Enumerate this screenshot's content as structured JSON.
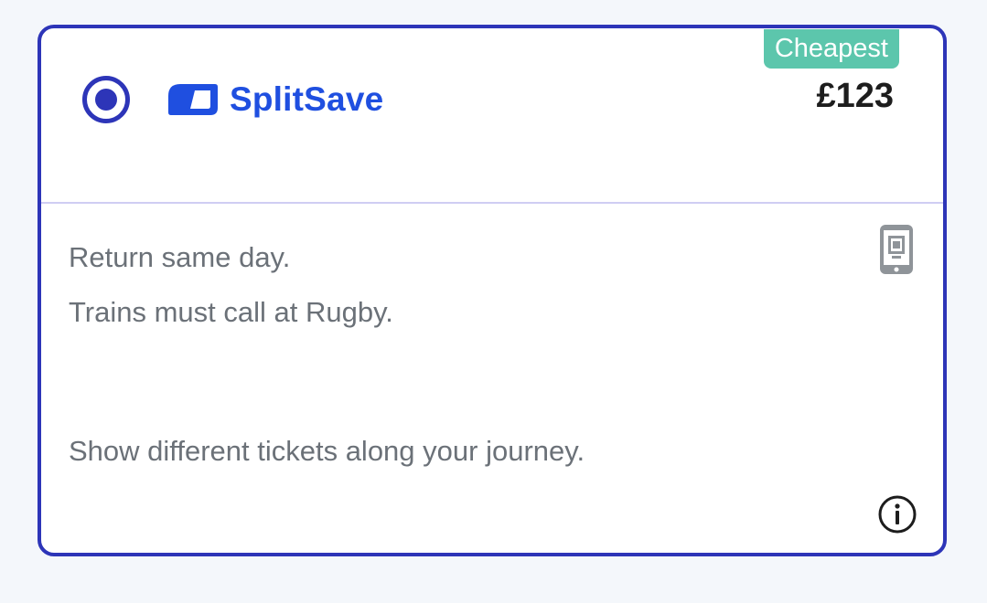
{
  "option": {
    "brand_name": "SplitSave",
    "badge": "Cheapest",
    "price": "£123",
    "selected": true
  },
  "details": {
    "lines": [
      "Return same day.",
      "Trains must call at Rugby."
    ],
    "split_link": "Show different tickets along your journey."
  },
  "colors": {
    "accent": "#2d35b8",
    "brand": "#1f4fe0",
    "badge_bg": "#5cc6ac",
    "divider": "#cfcdf3",
    "muted_text": "#6b7178"
  },
  "icons": {
    "radio": "radio-selected-icon",
    "logo": "splitsave-logo-icon",
    "ticket_type": "mobile-ticket-icon",
    "info": "info-icon"
  }
}
